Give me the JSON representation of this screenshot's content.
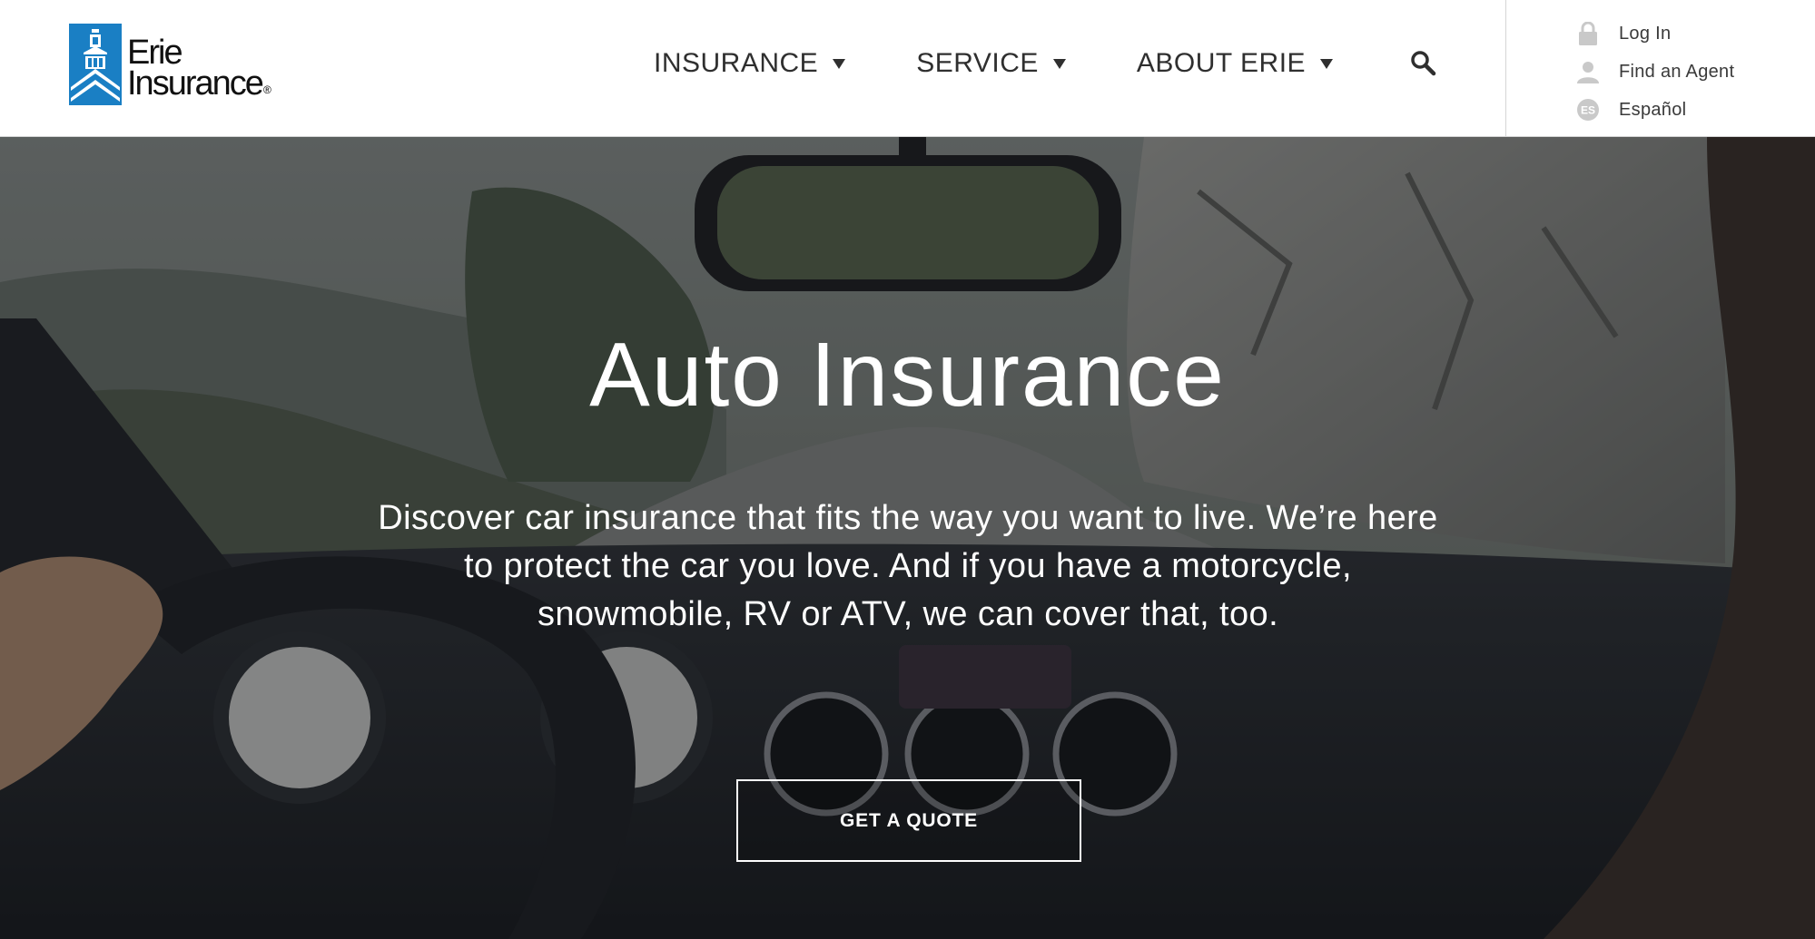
{
  "logo": {
    "line1": "Erie",
    "line2": "Insurance",
    "reg": "®",
    "brand_color": "#1a7fc4"
  },
  "nav": {
    "items": [
      {
        "label": "INSURANCE"
      },
      {
        "label": "SERVICE"
      },
      {
        "label": "ABOUT ERIE"
      }
    ],
    "search_icon": "search-icon"
  },
  "utility": {
    "login": {
      "label": "Log In",
      "icon": "lock-icon"
    },
    "agent": {
      "label": "Find an Agent",
      "icon": "person-icon"
    },
    "spanish": {
      "label": "Español",
      "icon": "es-badge-icon",
      "badge": "ES"
    }
  },
  "hero": {
    "title": "Auto Insurance",
    "description": "Discover car insurance that fits the way you want to live. We’re here to protect the car you love. And if you have a motorcycle, snowmobile, RV or ATV, we can cover that, too.",
    "cta_label": "GET A QUOTE"
  },
  "colors": {
    "header_bg": "#ffffff",
    "nav_text": "#2f2f2f",
    "utility_icon": "#c9c9c9",
    "hero_text": "#ffffff"
  }
}
